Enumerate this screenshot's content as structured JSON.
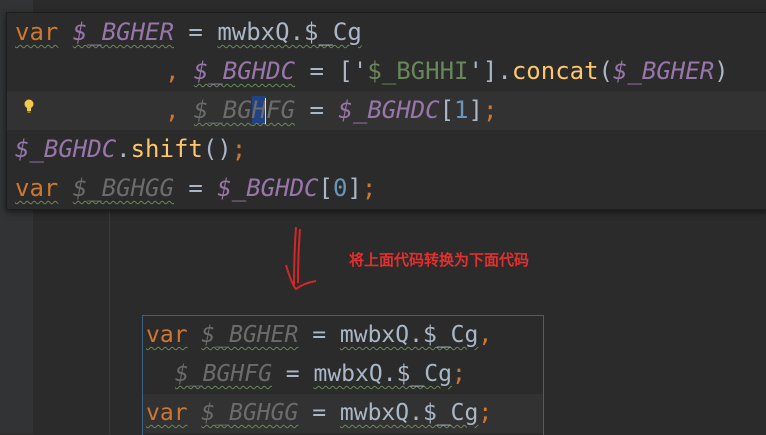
{
  "panel": {
    "lines": [
      {
        "kw": "var",
        "v1": "$_BGHER",
        "eq": " = ",
        "t1": "mwbxQ.$_Cg"
      },
      {
        "comma": ", ",
        "v1": "$_BGHDC",
        "eq": " = ",
        "open": "['",
        "str": "$_BGHHI",
        "close": "'].",
        "fn": "concat",
        "p1": "(",
        "v2": "$_BGHER",
        "p2": ")"
      },
      {
        "comma": ", ",
        "v1a": "$_BG",
        "v1b": "H",
        "v1c": "FG",
        "eq": " = ",
        "v2": "$_BGHDC",
        "open": "[",
        "num": "1",
        "close": "]",
        "semi": ";"
      },
      {
        "v1": "$_BGHDC",
        "dot": ".",
        "fn": "shift",
        "paren": "()",
        "semi": ";"
      },
      {
        "kw": "var",
        "v1": "$_BGHGG",
        "eq": " = ",
        "v2": "$_BGHDC",
        "open": "[",
        "num": "0",
        "close": "]",
        "semi": ";"
      }
    ]
  },
  "note": {
    "text": "将上面代码转换为下面代码",
    "color": "#e03030"
  },
  "result": {
    "lines": [
      {
        "kw": "var",
        "v1": "$_BGHER",
        "eq": " = ",
        "t1": "mwbxQ.$_Cg",
        "end": ","
      },
      {
        "v1": "$_BGHFG",
        "eq": " = ",
        "t1": "mwbxQ.$_Cg",
        "end": ";"
      },
      {
        "kw": "var",
        "v1": "$_BGHGG",
        "eq": " = ",
        "t1": "mwbxQ.$_Cg",
        "end": ";"
      }
    ]
  },
  "colors": {
    "background": "#2b2b2b",
    "keyword": "#cc7832",
    "variable": "#9876aa",
    "function": "#ffc66d",
    "string": "#6a8759",
    "number": "#6897bb",
    "text": "#a9b7c6"
  },
  "icons": {
    "bulb": "lightbulb-icon",
    "arrow": "down-arrow-icon"
  }
}
